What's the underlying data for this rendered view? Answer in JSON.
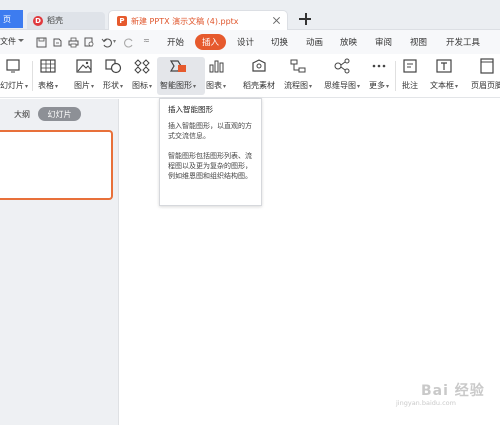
{
  "tabs": [
    {
      "label": "页"
    },
    {
      "label": "稻壳"
    },
    {
      "label": "新建 PPTX 演示文稿 (4).pptx"
    }
  ],
  "menu": {
    "file": "文件",
    "items": [
      "开始",
      "插入",
      "设计",
      "切换",
      "动画",
      "放映",
      "审阅",
      "视图",
      "开发工具"
    ],
    "active": "插入"
  },
  "ribbon": {
    "buttons": [
      {
        "label": "幻灯片",
        "icon": "new-slide-icon"
      },
      {
        "label": "表格",
        "icon": "table-icon"
      },
      {
        "label": "图片",
        "icon": "picture-icon"
      },
      {
        "label": "形状",
        "icon": "shapes-icon"
      },
      {
        "label": "图标",
        "icon": "icons-icon"
      },
      {
        "label": "智能图形",
        "icon": "smartart-icon"
      },
      {
        "label": "图表",
        "icon": "chart-icon"
      },
      {
        "label": "稻壳素材",
        "icon": "material-icon"
      },
      {
        "label": "流程图",
        "icon": "flowchart-icon"
      },
      {
        "label": "思维导图",
        "icon": "mindmap-icon"
      },
      {
        "label": "更多",
        "icon": "more-icon"
      },
      {
        "label": "批注",
        "icon": "comment-icon"
      },
      {
        "label": "文本框",
        "icon": "textbox-icon"
      },
      {
        "label": "页眉页脚",
        "icon": "header-footer-icon"
      }
    ]
  },
  "panel": {
    "outline": "大纲",
    "slides": "幻灯片"
  },
  "tooltip": {
    "title": "插入智能图形",
    "line1": "插入智能图形，以直观的方式交流信息。",
    "line2": "智能图形包括图形列表、流程图以及更为复杂的图形，例如维恩图和组织结构图。"
  },
  "watermark": {
    "text": "Bai 经验",
    "url": "jingyan.baidu.com"
  },
  "colors": {
    "accent": "#e65a2d",
    "brand_blue": "#3d7cf0",
    "panel_bg": "#eef0f3"
  }
}
